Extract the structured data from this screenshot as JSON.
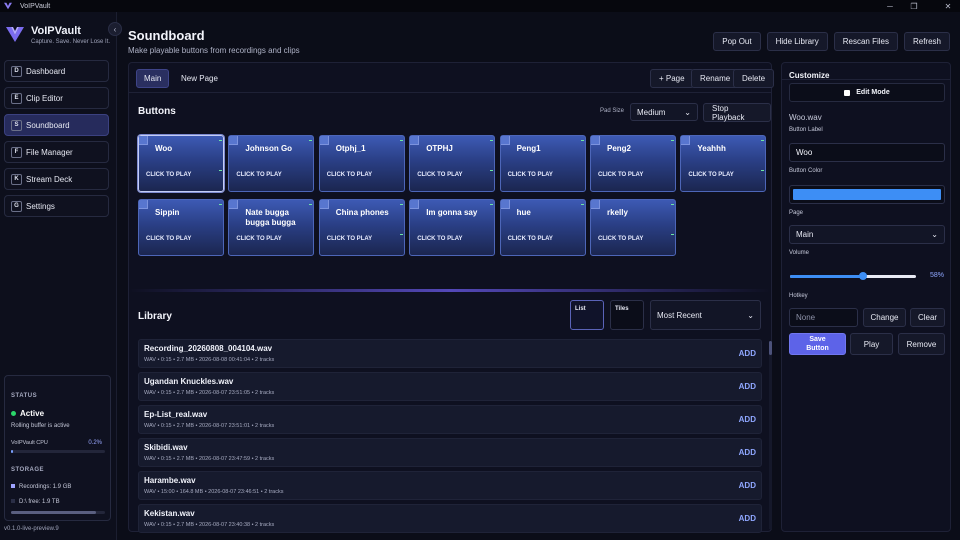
{
  "window": {
    "title": "VoIPVault",
    "minimize": "─",
    "maximize": "❐",
    "close": "✕"
  },
  "colors": {
    "accent": "#5d63e8",
    "pad": "#2a3f85",
    "button_color": "#3d8ef5",
    "status_active": "#2bd66a"
  },
  "sidebar": {
    "brand_name": "VoIPVault",
    "tagline": "Capture. Save. Never Lose It.",
    "collapse_icon": "‹",
    "items": [
      {
        "key": "D",
        "label": "Dashboard"
      },
      {
        "key": "E",
        "label": "Clip Editor"
      },
      {
        "key": "S",
        "label": "Soundboard"
      },
      {
        "key": "F",
        "label": "File Manager"
      },
      {
        "key": "K",
        "label": "Stream Deck"
      },
      {
        "key": "G",
        "label": "Settings"
      }
    ],
    "status": {
      "heading": "STATUS",
      "state": "Active",
      "detail": "Rolling buffer is active",
      "cpu_label": "VoIPVault CPU",
      "cpu_value": "0.2%",
      "cpu_fraction": 0.02
    },
    "storage": {
      "heading": "STORAGE",
      "recordings": "Recordings: 1.9 GB",
      "free": "D:\\ free: 1.9 TB",
      "used_fraction": 0.9
    },
    "version": "v0.1.0-live-preview.9"
  },
  "header": {
    "title": "Soundboard",
    "subtitle": "Make playable buttons from recordings and clips",
    "buttons": [
      "Pop Out",
      "Hide Library",
      "Rescan Files",
      "Refresh"
    ]
  },
  "pages": {
    "tabs": [
      "Main",
      "New Page"
    ],
    "add_page": "+ Page",
    "rename": "Rename",
    "delete": "Delete"
  },
  "buttons_section": {
    "title": "Buttons",
    "pad_size_label": "Pad Size",
    "pad_size_value": "Medium",
    "stop_playback": "Stop Playback",
    "cta": "CLICK TO PLAY",
    "pads": [
      "Woo",
      "Johnson Go",
      "Otphj_1",
      "OTPHJ",
      "Peng1",
      "Peng2",
      "Yeahhh",
      "Sippin",
      "Nate bugga bugga bugga",
      "China phones",
      "Im gonna say",
      "hue",
      "rkelly"
    ]
  },
  "library": {
    "title": "Library",
    "view_list": "List",
    "view_tiles": "Tiles",
    "sort": "Most Recent",
    "add_label": "ADD",
    "rows": [
      {
        "name": "Recording_20260808_004104.wav",
        "meta": "WAV • 0:15 • 2.7 MB • 2026-08-08 00:41:04 • 2 tracks"
      },
      {
        "name": "Ugandan Knuckles.wav",
        "meta": "WAV • 0:15 • 2.7 MB • 2026-08-07 23:51:05 • 2 tracks"
      },
      {
        "name": "Ep-List_real.wav",
        "meta": "WAV • 0:15 • 2.7 MB • 2026-08-07 23:51:01 • 2 tracks"
      },
      {
        "name": "Skibidi.wav",
        "meta": "WAV • 0:15 • 2.7 MB • 2026-08-07 23:47:59 • 2 tracks"
      },
      {
        "name": "Harambe.wav",
        "meta": "WAV • 15:00 • 164.8 MB • 2026-08-07 23:46:51 • 2 tracks"
      },
      {
        "name": "Kekistan.wav",
        "meta": "WAV • 0:15 • 2.7 MB • 2026-08-07 23:40:38 • 2 tracks"
      }
    ]
  },
  "customize": {
    "title": "Customize",
    "edit_mode": "Edit Mode",
    "file_name": "Woo.wav",
    "button_label_heading": "Button Label",
    "button_label_value": "Woo",
    "button_color_heading": "Button Color",
    "page_heading": "Page",
    "page_value": "Main",
    "volume_heading": "Volume",
    "volume_value": "58%",
    "volume_fraction": 0.58,
    "hotkey_heading": "Hotkey",
    "hotkey_placeholder": "None",
    "change": "Change",
    "clear": "Clear",
    "save_button": "Save Button",
    "play": "Play",
    "remove": "Remove"
  }
}
